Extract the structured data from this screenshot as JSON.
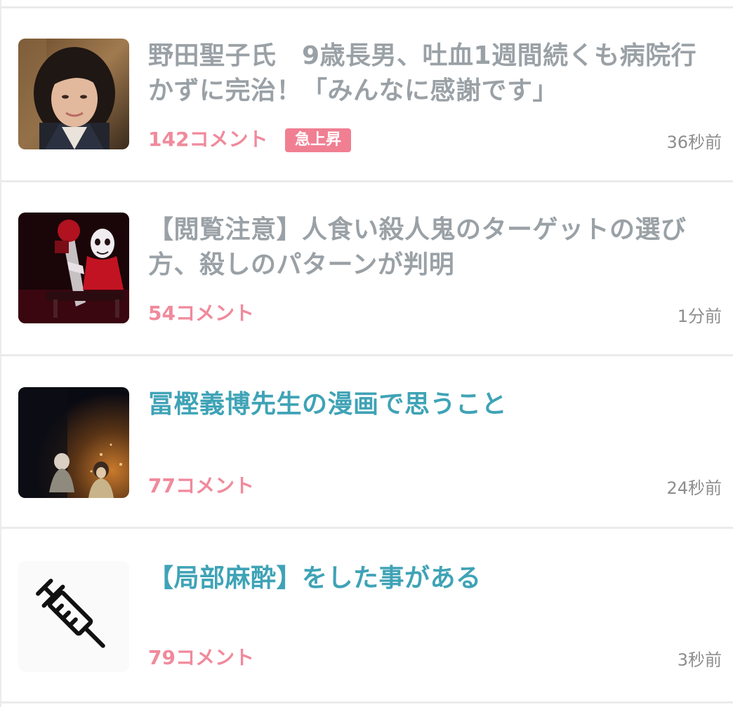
{
  "articles": [
    {
      "title": "野田聖子氏　9歳長男、吐血1週間続くも病院行かずに完治！「みんなに感謝です」",
      "comments": "142コメント",
      "badge": "急上昇",
      "time": "36秒前",
      "read": true,
      "thumbnail": "portrait-photo"
    },
    {
      "title": "【閲覧注意】人食い殺人鬼のターゲットの選び方、殺しのパターンが判明",
      "comments": "54コメント",
      "time": "1分前",
      "read": true,
      "thumbnail": "horror-performer-photo"
    },
    {
      "title": "冨樫義博先生の漫画で思うこと",
      "comments": "77コメント",
      "time": "24秒前",
      "read": false,
      "thumbnail": "manga-scene-image"
    },
    {
      "title": "【局部麻酔】をした事がある",
      "comments": "79コメント",
      "time": "3秒前",
      "read": false,
      "thumbnail": "syringe-icon"
    }
  ],
  "colors": {
    "read_title": "#9aa1a6",
    "unread_title": "#3fa3b6",
    "comment_count": "#f08a9c",
    "badge_bg": "#f07f92",
    "timestamp": "#8d8d8d",
    "divider": "#ebebeb"
  }
}
